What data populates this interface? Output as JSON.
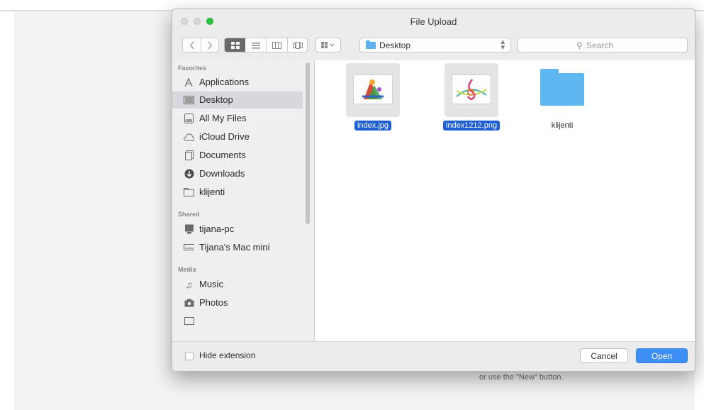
{
  "background": {
    "hint_text": "or use the \"New\" button."
  },
  "dialog": {
    "title": "File Upload",
    "toolbar": {
      "back_icon": "chevron-left",
      "forward_icon": "chevron-right",
      "view_modes": [
        "icon-view",
        "list-view",
        "column-view",
        "coverflow-view"
      ],
      "arrange_icon": "arrange-grid",
      "location": "Desktop",
      "search_placeholder": "Search"
    },
    "sidebar": {
      "favorites_heading": "Favorites",
      "shared_heading": "Shared",
      "media_heading": "Media",
      "favorites": [
        {
          "label": "Applications",
          "icon": "applications-icon"
        },
        {
          "label": "Desktop",
          "icon": "desktop-icon",
          "selected": true
        },
        {
          "label": "All My Files",
          "icon": "all-files-icon"
        },
        {
          "label": "iCloud Drive",
          "icon": "cloud-icon"
        },
        {
          "label": "Documents",
          "icon": "documents-icon"
        },
        {
          "label": "Downloads",
          "icon": "downloads-icon"
        },
        {
          "label": "klijenti",
          "icon": "folder-icon"
        }
      ],
      "shared": [
        {
          "label": "tijana-pc",
          "icon": "pc-icon"
        },
        {
          "label": "Tijana's Mac mini",
          "icon": "mac-mini-icon"
        }
      ],
      "media": [
        {
          "label": "Music",
          "icon": "music-icon"
        },
        {
          "label": "Photos",
          "icon": "photos-icon"
        }
      ]
    },
    "files": [
      {
        "name": "index.jpg",
        "kind": "image",
        "selected": true
      },
      {
        "name": "index1212.png",
        "kind": "image",
        "selected": true
      },
      {
        "name": "klijenti",
        "kind": "folder",
        "selected": false
      }
    ],
    "footer": {
      "hide_extension_label": "Hide extension",
      "cancel_label": "Cancel",
      "open_label": "Open"
    },
    "colors": {
      "accent": "#3d8ff6",
      "selection": "#1f5fd6",
      "folder": "#5fb7f2",
      "zoom_button": "#2bc63e"
    }
  }
}
